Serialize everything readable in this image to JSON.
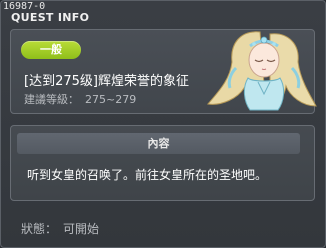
{
  "window": {
    "id": "16987-0",
    "title": "QUEST INFO"
  },
  "quest": {
    "badge": "一般",
    "title": "[达到275级]辉煌荣誉的象征",
    "level_label": "建議等級：",
    "level_range": "275~279",
    "portrait_icon": "queen-portrait-icon"
  },
  "content": {
    "header": "內容",
    "text": "听到女皇的召唤了。前往女皇所在的圣地吧。"
  },
  "status": {
    "label": "狀態：",
    "value": "可開始"
  },
  "colors": {
    "badge_green": "#9ccb22",
    "panel_border": "#676c73",
    "background": "#33373c"
  }
}
